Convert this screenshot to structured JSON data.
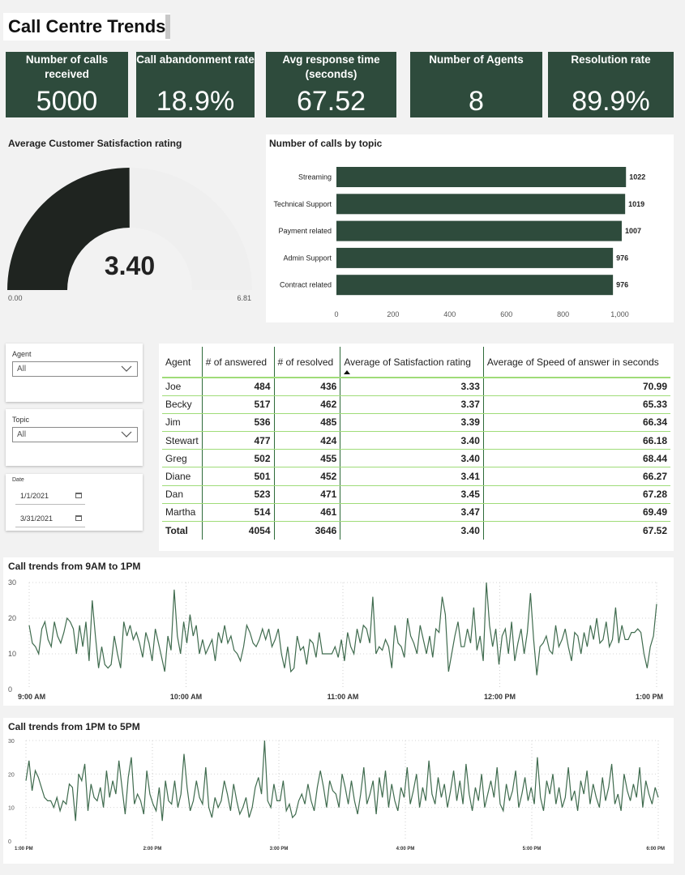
{
  "page": {
    "title": "Call Centre Trends"
  },
  "kpis": [
    {
      "label": "Number of calls received",
      "value": "5000"
    },
    {
      "label": "Call abandonment rate",
      "value": "18.9%"
    },
    {
      "label": "Avg response time (seconds)",
      "value": "67.52"
    },
    {
      "label": "Number of Agents",
      "value": "8"
    },
    {
      "label": "Resolution rate",
      "value": "89.9%"
    }
  ],
  "colors": {
    "kpi_bg": "#2e4b3c",
    "bar": "#2e4b3c",
    "gauge_fill": "#1f2420",
    "gauge_bg": "#efefef",
    "line": "#3f6b4e",
    "table_grid": "#9fdc78"
  },
  "slicers": {
    "agent": {
      "label": "Agent",
      "value": "All"
    },
    "topic": {
      "label": "Topic",
      "value": "All"
    },
    "date": {
      "label": "Date",
      "start": "1/1/2021",
      "end": "3/31/2021"
    }
  },
  "table": {
    "headers": [
      "Agent",
      "# of answered",
      "# of resolved",
      "Average of Satisfaction rating",
      "Average of Speed of answer in seconds"
    ],
    "rows": [
      [
        "Joe",
        "484",
        "436",
        "3.33",
        "70.99"
      ],
      [
        "Becky",
        "517",
        "462",
        "3.37",
        "65.33"
      ],
      [
        "Jim",
        "536",
        "485",
        "3.39",
        "66.34"
      ],
      [
        "Stewart",
        "477",
        "424",
        "3.40",
        "66.18"
      ],
      [
        "Greg",
        "502",
        "455",
        "3.40",
        "68.44"
      ],
      [
        "Diane",
        "501",
        "452",
        "3.41",
        "66.27"
      ],
      [
        "Dan",
        "523",
        "471",
        "3.45",
        "67.28"
      ],
      [
        "Martha",
        "514",
        "461",
        "3.47",
        "69.49"
      ]
    ],
    "total": [
      "Total",
      "4054",
      "3646",
      "3.40",
      "67.52"
    ]
  },
  "chart_data": [
    {
      "type": "gauge",
      "title": "Average Customer Satisfaction rating",
      "value": 3.4,
      "value_label": "3.40",
      "min": 0,
      "max": 6.81,
      "min_label": "0.00",
      "max_label": "6.81"
    },
    {
      "type": "bar",
      "orientation": "horizontal",
      "title": "Number of calls by topic",
      "categories": [
        "Streaming",
        "Technical Support",
        "Payment related",
        "Admin Support",
        "Contract related"
      ],
      "values": [
        1022,
        1019,
        1007,
        976,
        976
      ],
      "xlim": [
        0,
        1050
      ],
      "xticks": [
        0,
        200,
        400,
        600,
        800,
        1000
      ],
      "xtick_labels": [
        "0",
        "200",
        "400",
        "600",
        "800",
        "1,000"
      ]
    },
    {
      "type": "line",
      "title": "Call trends from 9AM to 1PM",
      "ylim": [
        0,
        30
      ],
      "yticks": [
        0,
        10,
        20,
        30
      ],
      "xticks": [
        "9:00 AM",
        "10:00 AM",
        "11:00 AM",
        "12:00 PM",
        "1:00 PM"
      ],
      "x_range": [
        "9:00 AM",
        "1:00 PM"
      ],
      "values": [
        18,
        13,
        12,
        10,
        17,
        19,
        14,
        12,
        19,
        15,
        13,
        16,
        20,
        19,
        17,
        10,
        18,
        12,
        19,
        8,
        25,
        15,
        6,
        12,
        7,
        6,
        7,
        15,
        10,
        6,
        19,
        15,
        18,
        14,
        16,
        13,
        9,
        16,
        13,
        8,
        17,
        13,
        9,
        5,
        15,
        11,
        28,
        15,
        10,
        19,
        13,
        21,
        15,
        18,
        10,
        14,
        10,
        12,
        14,
        8,
        16,
        13,
        18,
        13,
        15,
        11,
        10,
        8,
        12,
        18,
        16,
        13,
        12,
        14,
        17,
        14,
        17,
        12,
        14,
        17,
        10,
        6,
        12,
        5,
        6,
        15,
        11,
        12,
        7,
        14,
        13,
        9,
        16,
        10,
        10,
        10,
        10,
        12,
        9,
        14,
        8,
        16,
        12,
        10,
        17,
        13,
        18,
        17,
        13,
        26,
        10,
        12,
        11,
        14,
        12,
        6,
        18,
        13,
        12,
        9,
        20,
        15,
        13,
        10,
        18,
        14,
        10,
        15,
        9,
        17,
        16,
        26,
        21,
        5,
        10,
        15,
        19,
        12,
        12,
        17,
        13,
        23,
        11,
        15,
        8,
        30,
        18,
        12,
        17,
        7,
        15,
        17,
        10,
        19,
        8,
        13,
        17,
        10,
        16,
        27,
        14,
        4,
        12,
        13,
        15,
        11,
        10,
        18,
        12,
        14,
        17,
        12,
        8,
        16,
        15,
        10,
        16,
        12,
        18,
        14,
        20,
        13,
        14,
        19,
        12,
        14,
        23,
        13,
        18,
        14,
        14,
        16,
        16,
        17,
        16,
        10,
        6,
        12,
        15,
        24
      ]
    },
    {
      "type": "line",
      "title": "Call trends from 1PM to 5PM",
      "ylim": [
        0,
        30
      ],
      "yticks": [
        0,
        10,
        20,
        30
      ],
      "xticks": [
        "1:00 PM",
        "2:00 PM",
        "3:00 PM",
        "4:00 PM",
        "5:00 PM",
        "6:00 PM"
      ],
      "x_range": [
        "1:00 PM",
        "6:00 PM"
      ],
      "values": [
        18,
        24,
        15,
        21,
        19,
        16,
        13,
        12,
        12,
        10,
        13,
        9,
        12,
        11,
        17,
        16,
        6,
        20,
        18,
        23,
        9,
        17,
        13,
        12,
        16,
        10,
        21,
        13,
        18,
        14,
        24,
        16,
        8,
        19,
        25,
        11,
        14,
        12,
        8,
        21,
        14,
        11,
        9,
        16,
        6,
        18,
        12,
        11,
        18,
        10,
        14,
        26,
        16,
        9,
        12,
        18,
        13,
        11,
        22,
        10,
        7,
        13,
        10,
        12,
        18,
        14,
        9,
        17,
        12,
        8,
        10,
        13,
        7,
        10,
        16,
        19,
        14,
        30,
        12,
        10,
        17,
        12,
        12,
        18,
        9,
        11,
        7,
        8,
        12,
        14,
        11,
        17,
        12,
        9,
        16,
        21,
        16,
        10,
        18,
        15,
        14,
        10,
        20,
        16,
        11,
        18,
        12,
        8,
        14,
        22,
        11,
        14,
        18,
        8,
        19,
        13,
        21,
        10,
        17,
        12,
        9,
        16,
        13,
        22,
        11,
        15,
        20,
        10,
        16,
        12,
        24,
        14,
        11,
        19,
        13,
        17,
        10,
        15,
        21,
        12,
        18,
        11,
        23,
        14,
        9,
        16,
        12,
        20,
        10,
        14,
        18,
        13,
        22,
        11,
        9,
        17,
        12,
        15,
        21,
        10,
        14,
        19,
        12,
        16,
        11,
        25,
        13,
        9,
        18,
        14,
        20,
        11,
        16,
        10,
        13,
        22,
        12,
        15,
        9,
        18,
        14,
        21,
        11,
        17,
        13,
        10,
        19,
        12,
        16,
        23,
        11,
        14,
        9,
        20,
        15,
        12,
        17,
        13,
        22,
        10,
        18,
        14,
        11,
        16,
        13
      ]
    }
  ]
}
